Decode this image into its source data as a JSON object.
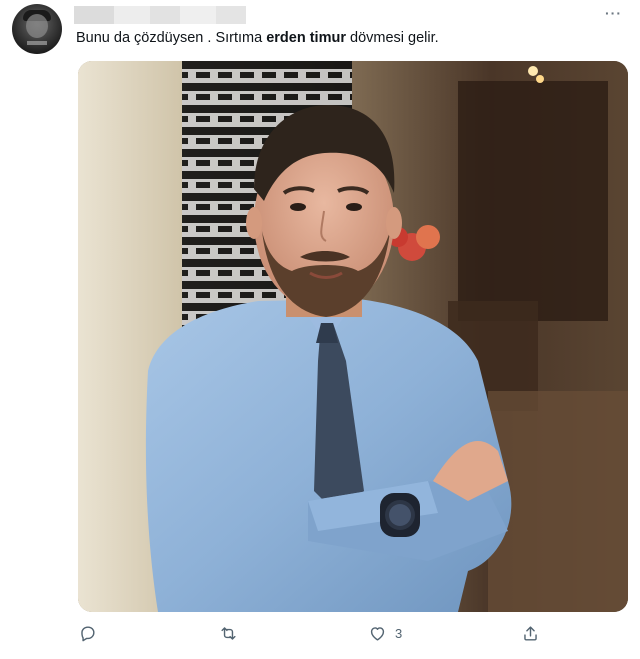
{
  "tweet": {
    "text_before": "Bunu da çözdüysen . Sırtıma ",
    "text_bold": "erden timur",
    "text_after": " dövmesi gelir."
  },
  "actions": {
    "reply": {
      "icon": "reply-icon"
    },
    "retweet": {
      "icon": "retweet-icon"
    },
    "like": {
      "icon": "heart-icon",
      "count": "3"
    },
    "share": {
      "icon": "share-icon"
    }
  },
  "menu": {
    "icon": "more-icon",
    "glyph": "···"
  },
  "colors": {
    "text": "#0f1419",
    "secondary": "#536471",
    "shirt": "#8fb2d8",
    "tie": "#3c4a5e"
  }
}
